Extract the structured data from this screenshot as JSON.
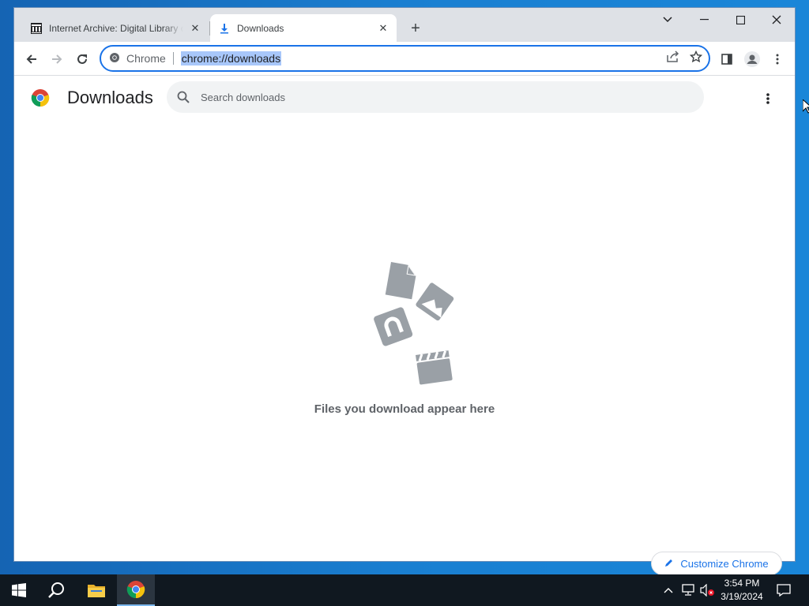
{
  "browser": {
    "tabs": [
      {
        "title": "Internet Archive: Digital Library of Free & Borrowable Books, Movies, Music & Wayback Machine",
        "icon": "archive-icon",
        "active": false
      },
      {
        "title": "Downloads",
        "icon": "download-icon",
        "active": true
      }
    ],
    "omnibox": {
      "chip_label": "Chrome",
      "url": "chrome://downloads"
    }
  },
  "page": {
    "title": "Downloads",
    "search_placeholder": "Search downloads",
    "empty_message": "Files you download appear here",
    "customize_label": "Customize Chrome"
  },
  "taskbar": {
    "time": "3:54 PM",
    "date": "3/19/2024"
  },
  "colors": {
    "accent": "#1a73e8",
    "url_highlight": "#a8c7fa",
    "illustration": "#9aa0a6"
  }
}
